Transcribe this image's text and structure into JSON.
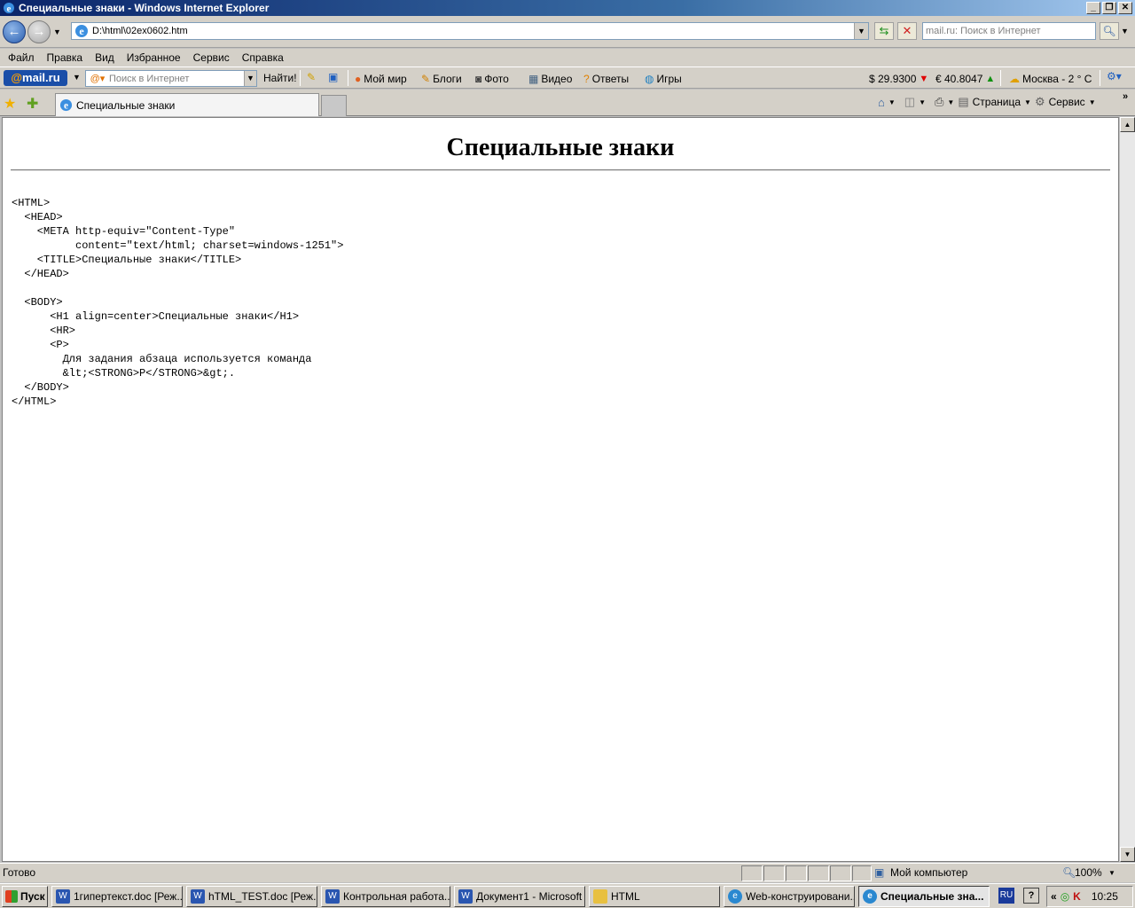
{
  "window": {
    "title": "Специальные знаки - Windows Internet Explorer",
    "minimize": "_",
    "maximize": "❐",
    "close": "✕"
  },
  "addressbar": {
    "url": "D:\\html\\02ex0602.htm",
    "search_placeholder": "mail.ru: Поиск в Интернет"
  },
  "menu": [
    "Файл",
    "Правка",
    "Вид",
    "Избранное",
    "Сервис",
    "Справка"
  ],
  "mailru": {
    "logo": "mail.ru",
    "search_placeholder": "Поиск в Интернет",
    "find_label": "Найти!",
    "links": [
      "Мой мир",
      "Блоги",
      "Фото",
      "Видео",
      "Ответы",
      "Игры"
    ],
    "usd": "$ 29.9300",
    "eur": "€ 40.8047",
    "weather": "Москва - 2 ° C",
    "colors": {
      "down": "#e00000",
      "up": "#109010"
    }
  },
  "tabs": {
    "active_label": "Специальные знаки"
  },
  "commandbar": {
    "page_label": "Страница",
    "tools_label": "Сервис"
  },
  "content": {
    "heading": "Специальные знаки",
    "code": "<HTML>\n  <HEAD>\n    <META http-equiv=\"Content-Type\"\n          content=\"text/html; charset=windows-1251\">\n    <TITLE>Специальные знаки</TITLE>\n  </HEAD>\n\n  <BODY>\n      <H1 align=center>Специальные знаки</H1>\n      <HR>\n      <P>\n        Для задания абзаца используется команда\n        &lt;<STRONG>P</STRONG>&gt;.\n  </BODY>\n</HTML>"
  },
  "statusbar": {
    "status": "Готово",
    "zone": "Мой компьютер",
    "zoom": "100%"
  },
  "taskbar": {
    "start": "Пуск",
    "items": [
      {
        "label": "1гипертекст.doc [Реж...",
        "icon": "word-icon"
      },
      {
        "label": "hTML_TEST.doc [Реж...",
        "icon": "word-icon"
      },
      {
        "label": "Контрольная работа...",
        "icon": "word-icon"
      },
      {
        "label": "Документ1 - Microsoft ...",
        "icon": "word-icon"
      },
      {
        "label": "HTML",
        "icon": "folder-icon"
      },
      {
        "label": "Web-конструировани...",
        "icon": "ie-icon"
      },
      {
        "label": "Специальные зна...",
        "icon": "ie-icon"
      }
    ],
    "lang": "RU",
    "clock": "10:25"
  }
}
